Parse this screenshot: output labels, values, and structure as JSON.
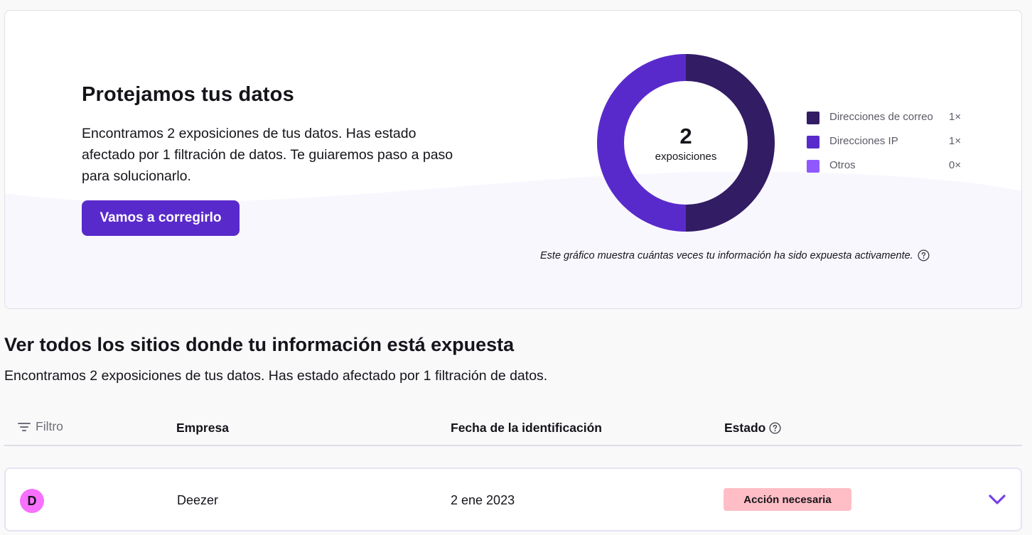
{
  "hero": {
    "title": "Protejamos tus datos",
    "text": "Encontramos 2 exposiciones de tus datos. Has estado afectado por 1 filtración de datos. Te guiaremos paso a paso para solucionarlo.",
    "button_label": "Vamos a corregirlo"
  },
  "chart_data": {
    "type": "pie",
    "center_value": "2",
    "center_label": "exposiciones",
    "slices": [
      {
        "label": "Direcciones de correo",
        "value": 1,
        "display": "1×",
        "color": "#321c64"
      },
      {
        "label": "Direcciones IP",
        "value": 1,
        "display": "1×",
        "color": "#592acb"
      },
      {
        "label": "Otros",
        "value": 0,
        "display": "0×",
        "color": "#9059ff"
      }
    ],
    "note": "Este gráfico muestra cuántas veces tu información ha sido expuesta activamente."
  },
  "exposures": {
    "title": "Ver todos los sitios donde tu información está expuesta",
    "text": "Encontramos 2 exposiciones de tus datos. Has estado afectado por 1 filtración de datos.",
    "filter_label": "Filtro",
    "columns": {
      "company": "Empresa",
      "date": "Fecha de la identificación",
      "status": "Estado"
    },
    "rows": [
      {
        "initial": "D",
        "company": "Deezer",
        "date": "2 ene 2023",
        "status": "Acción necesaria"
      }
    ]
  },
  "colors": {
    "accent": "#592acb",
    "badge_bg": "#ffbdc5",
    "avatar_bg": "#f770ff"
  }
}
